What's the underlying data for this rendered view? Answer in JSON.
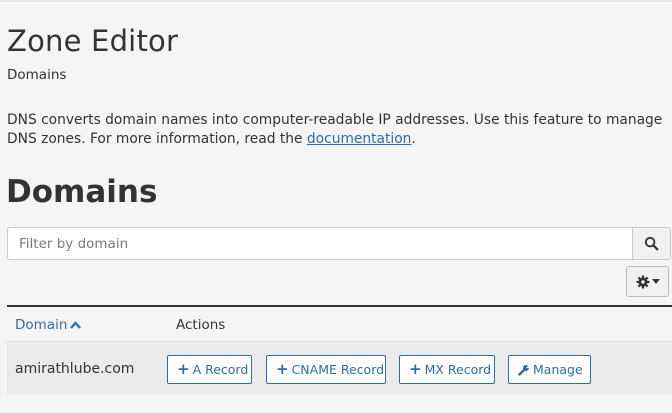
{
  "page": {
    "title": "Zone Editor",
    "breadcrumb": "Domains",
    "description_text": "DNS converts domain names into computer-readable IP addresses. Use this feature to manage DNS zones. For more information, read the ",
    "description_link": "documentation",
    "description_end": "."
  },
  "section": {
    "title": "Domains"
  },
  "search": {
    "placeholder": "Filter by domain",
    "value": "",
    "icon": "search-icon"
  },
  "settings": {
    "icon": "gear-icon",
    "caret_icon": "caret-down-icon"
  },
  "table": {
    "columns": [
      {
        "label": "Domain",
        "sorted": "ascending",
        "sort_icon": "chevron-up-icon"
      },
      {
        "label": "Actions"
      }
    ],
    "rows": [
      {
        "domain": "amirathlube.com",
        "actions": [
          {
            "label": "A Record",
            "icon": "plus-icon"
          },
          {
            "label": "CNAME Record",
            "icon": "plus-icon"
          },
          {
            "label": "MX Record",
            "icon": "plus-icon"
          },
          {
            "label": "Manage",
            "icon": "wrench-icon"
          }
        ]
      }
    ]
  },
  "colors": {
    "link": "#2e6da4",
    "text": "#333333",
    "background": "#f5f5f5",
    "row_background": "#ebebeb"
  }
}
